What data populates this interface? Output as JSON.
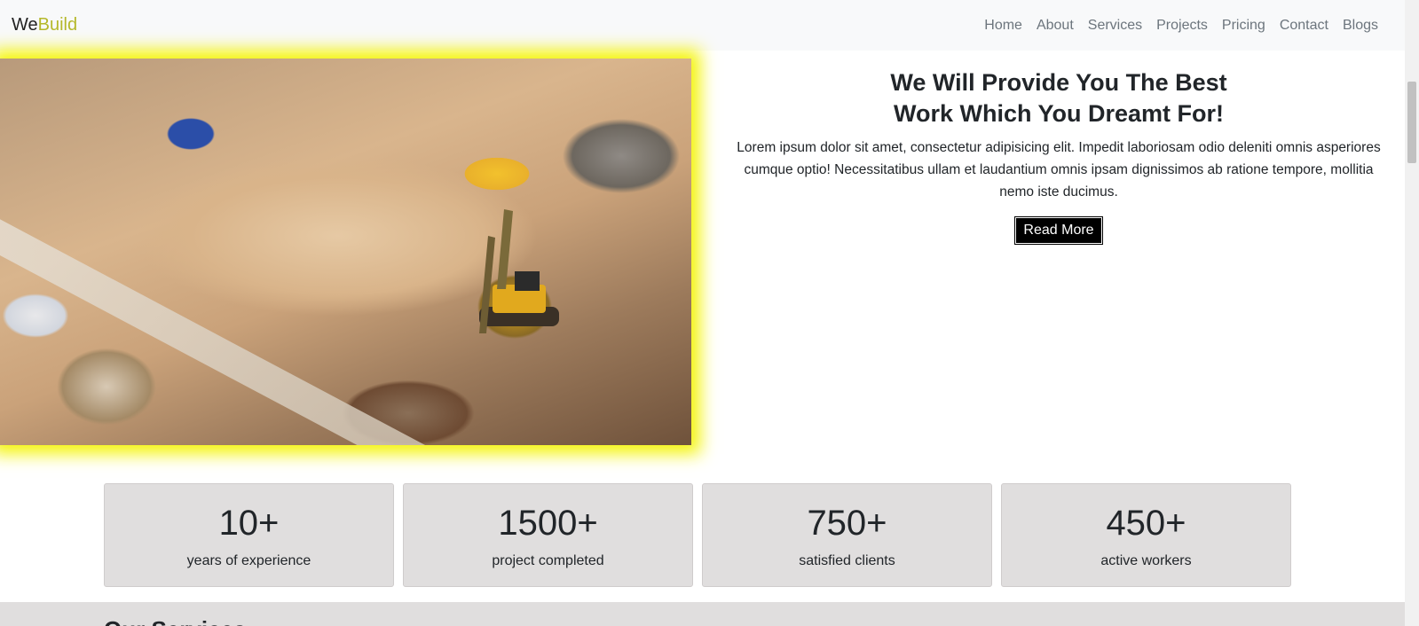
{
  "navbar": {
    "brand_part1": "We",
    "brand_part2": "Build",
    "links": [
      "Home",
      "About",
      "Services",
      "Projects",
      "Pricing",
      "Contact",
      "Blogs"
    ]
  },
  "hero": {
    "title_line1": "We Will Provide You The Best",
    "title_line2": "Work Which You Dreamt For!",
    "description": "Lorem ipsum dolor sit amet, consectetur adipisicing elit. Impedit laboriosam odio deleniti omnis asperiores cumque optio! Necessitatibus ullam et laudantium omnis ipsam dignissimos ab ratione tempore, mollitia nemo iste ducimus.",
    "button_label": "Read More",
    "image_alt": "construction-site-image"
  },
  "stats": [
    {
      "value": "10+",
      "label": "years of experience"
    },
    {
      "value": "1500+",
      "label": "project completed"
    },
    {
      "value": "750+",
      "label": "satisfied clients"
    },
    {
      "value": "450+",
      "label": "active workers"
    }
  ],
  "services": {
    "title": "Our Services"
  },
  "colors": {
    "brand_accent": "#b5b82a",
    "image_glow": "#f4f40a",
    "stat_bg": "#e0dede",
    "button_bg": "#000000"
  }
}
